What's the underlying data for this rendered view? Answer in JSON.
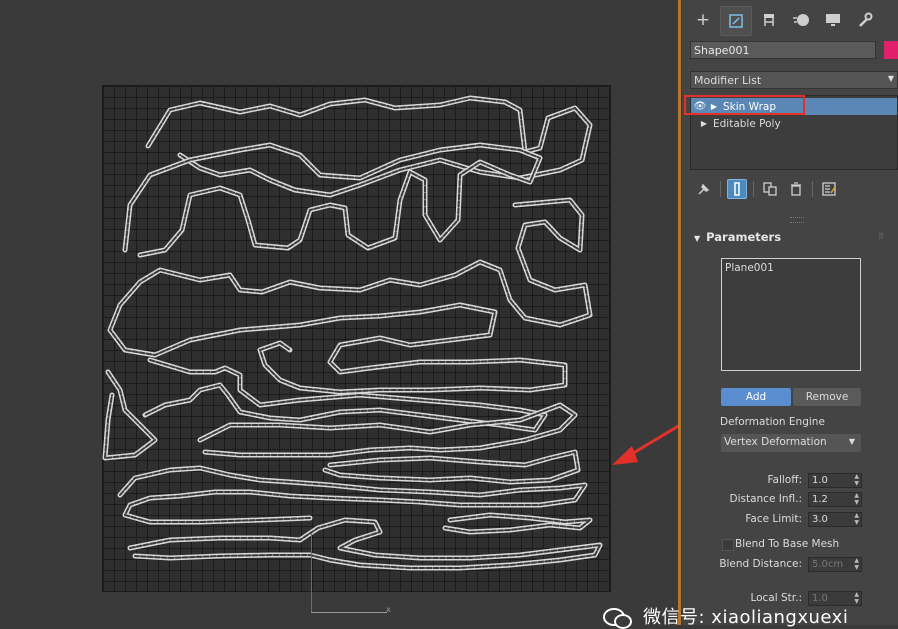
{
  "viewport": {
    "axis_label": "x"
  },
  "panel": {
    "tabs": [
      {
        "icon": "create-icon",
        "glyph": "+"
      },
      {
        "icon": "modify-icon",
        "glyph": "⌸"
      },
      {
        "icon": "hierarchy-icon",
        "glyph": "⊞"
      },
      {
        "icon": "motion-icon",
        "glyph": "●"
      },
      {
        "icon": "display-icon",
        "glyph": "▬"
      },
      {
        "icon": "utilities-icon",
        "glyph": "🔧"
      }
    ],
    "object_name": "Shape001",
    "object_color": "#e0206a",
    "modifier_list": "Modifier List",
    "stack": [
      {
        "label": "Skin Wrap",
        "selected": true
      },
      {
        "label": "Editable Poly",
        "selected": false
      }
    ],
    "tools": [
      {
        "icon": "pin-stack-icon",
        "glyph": "✎"
      },
      {
        "icon": "show-end-result-icon",
        "glyph": "┃"
      },
      {
        "icon": "make-unique-icon",
        "glyph": "❐"
      },
      {
        "icon": "remove-modifier-icon",
        "glyph": "🗑"
      },
      {
        "icon": "configure-modifier-sets-icon",
        "glyph": "▦"
      }
    ],
    "parameters_title": "Parameters",
    "target_list": [
      "Plane001"
    ],
    "add_label": "Add",
    "remove_label": "Remove",
    "deformation_engine_label": "Deformation Engine",
    "deformation_engine_value": "Vertex Deformation",
    "falloff_label": "Falloff:",
    "falloff_value": "1.0",
    "distance_infl_label": "Distance Infl.:",
    "distance_infl_value": "1.2",
    "face_limit_label": "Face Limit:",
    "face_limit_value": "3.0",
    "blend_to_base_label": "Blend To Base Mesh",
    "blend_distance_label": "Blend Distance:",
    "blend_distance_value": "5.0cm",
    "local_str_label": "Local Str.:",
    "local_str_value": "1.0"
  },
  "watermark": {
    "text": "微信号: xiaoliangxuexi"
  }
}
